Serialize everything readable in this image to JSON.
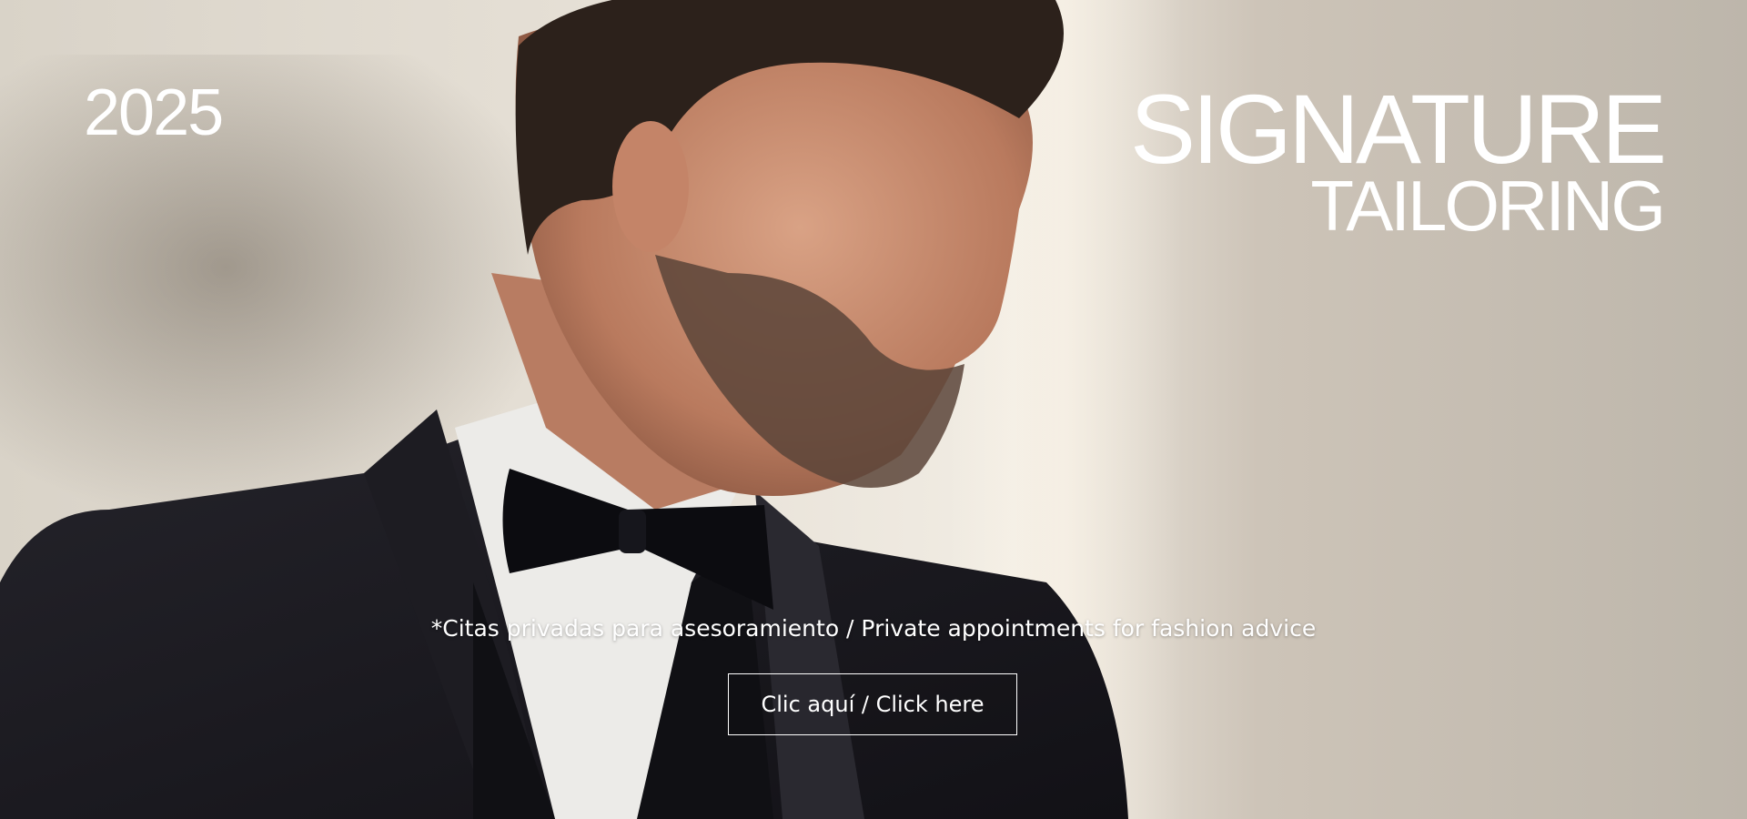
{
  "hero": {
    "year": "2025",
    "brand_line1": "SIGNATURE",
    "brand_line2": "TAILORING",
    "tagline": "*Citas privadas para asesoramiento / Private appointments for fashion advice",
    "cta_label": "Clic aquí / Click here"
  },
  "colors": {
    "text": "#ffffff",
    "background": "#d9d3c8",
    "suit": "#17161b"
  },
  "image": {
    "subject": "man-in-tuxedo-photo"
  }
}
